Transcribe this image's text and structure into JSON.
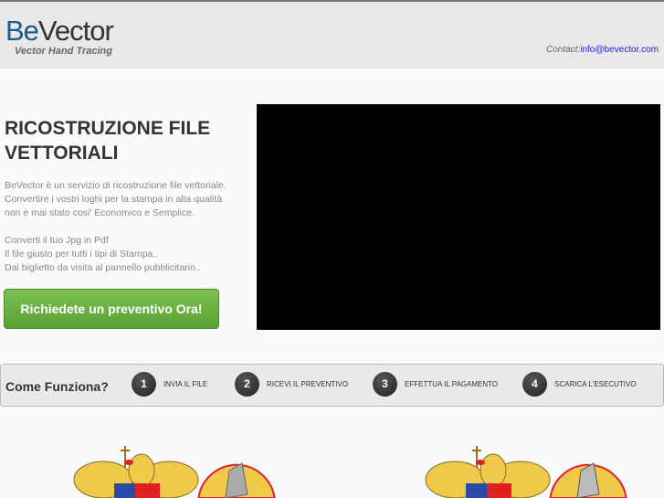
{
  "header": {
    "logo_be": "Be",
    "logo_vector": "Vector",
    "tagline": "Vector Hand Tracing",
    "contact_label": "Contact:",
    "contact_email": "info@bevector.com"
  },
  "hero": {
    "title": "RICOSTRUZIONE FILE VETTORIALI",
    "desc": [
      "BeVector è un servizio di ricostruzione file vettoriale.",
      "Convertire i vostri loghi per la stampa in alta qualità",
      "non è mai stato cosi' Economico e Semplice.",
      "",
      "Converti il tuo Jpg in Pdf",
      "Il file giusto per tutti i tipi di Stampa..",
      "Dal biglietto da visita al pannello pubblicitario.."
    ],
    "cta": "Richiedete un preventivo Ora!"
  },
  "how": {
    "title": "Come Funziona?",
    "steps": [
      {
        "n": "1",
        "label": "INVIA IL FILE"
      },
      {
        "n": "2",
        "label": "RICEVI IL PREVENTIVO"
      },
      {
        "n": "3",
        "label": "EFFETTUA IL PAGAMENTO"
      },
      {
        "n": "4",
        "label": "SCARICA L'ESECUTIVO"
      }
    ]
  }
}
